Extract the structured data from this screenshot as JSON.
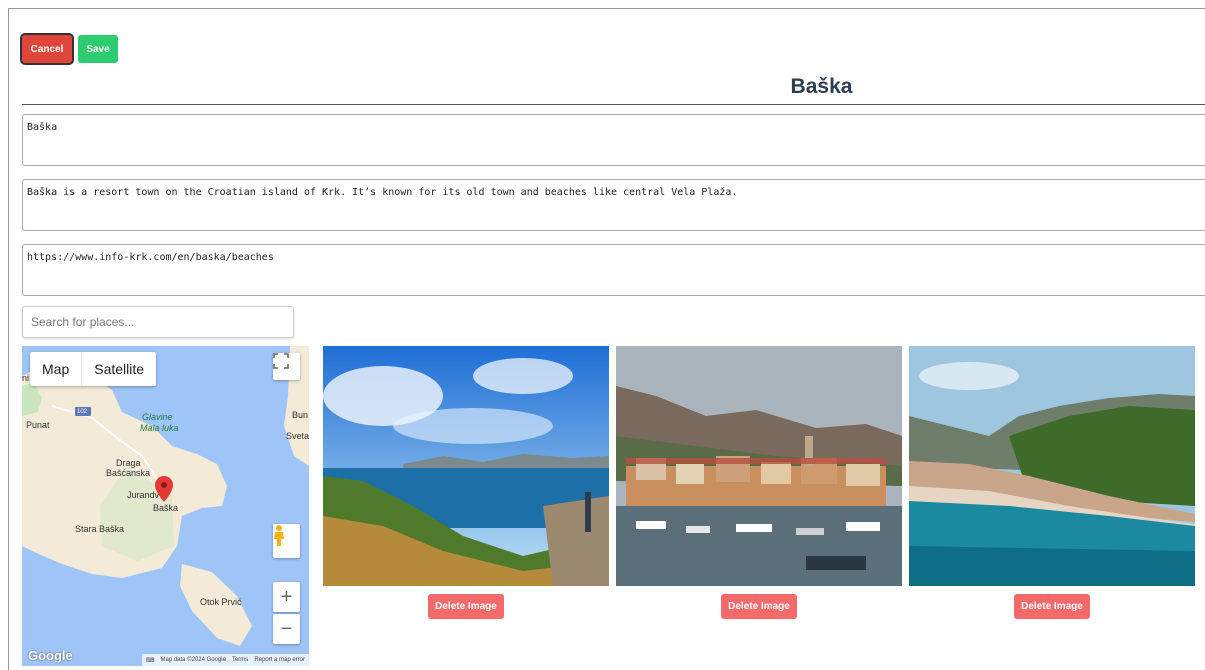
{
  "toolbar": {
    "cancel_label": "Cancel",
    "save_label": "Save"
  },
  "page_title": "Baška",
  "form": {
    "name_value": "Baška",
    "description_value": "Baška is a resort town on the Croatian island of Krk. It’s known for its old town and beaches like central Vela Plaža.",
    "url_value": "https://www.info-krk.com/en/baska/beaches"
  },
  "search": {
    "placeholder": "Search for places..."
  },
  "map": {
    "type_options": [
      "Map",
      "Satellite"
    ],
    "selected_type": "Map",
    "labels": {
      "punat": "Punat",
      "glavine": "Glavine",
      "mala_luka": "Mala luka",
      "draga": "Draga",
      "bascanska": "Bašćanska",
      "jurandvor": "Jurandv",
      "baska": "Baška",
      "stara_baska": "Stara Baška",
      "otok_prvic": "Otok Prvić",
      "bun": "Bun",
      "sveta": "Sveta",
      "road_102": "102",
      "edge_ni": "ni"
    },
    "zoom_in": "+",
    "zoom_out": "−",
    "logo": "Google",
    "footer": {
      "data": "Map data ©2024 Google",
      "terms": "Terms",
      "report": "Report a map error"
    },
    "colors": {
      "land": "#f3ead7",
      "water": "#9fc5f8",
      "pin": "#e53935",
      "park": "#c9e6c1"
    }
  },
  "images": [
    {
      "delete_label": "Delete Image"
    },
    {
      "delete_label": "Delete Image"
    },
    {
      "delete_label": "Delete Image"
    }
  ],
  "colors": {
    "cancel": "#e0453a",
    "save": "#2ecc71",
    "delete": "#f26a6a",
    "title": "#2c3e50"
  }
}
